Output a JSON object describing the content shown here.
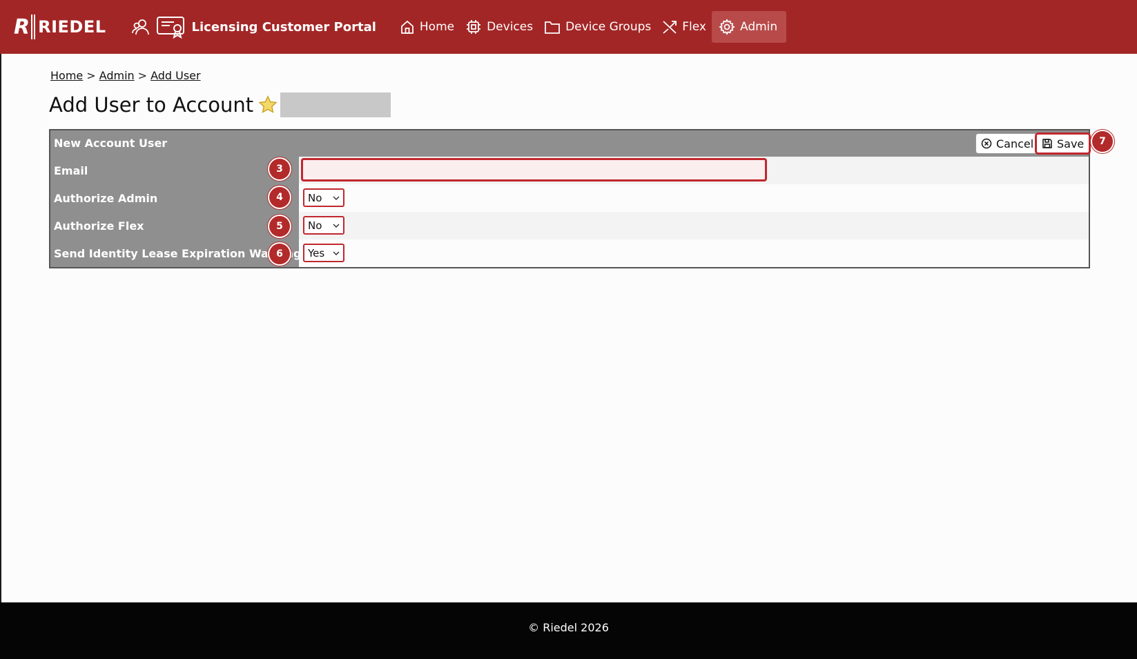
{
  "brand": {
    "logo_mark": "R",
    "logo_text": "RIEDEL",
    "portal_title": "Licensing Customer Portal",
    "accent": "#a32626"
  },
  "nav": {
    "items": [
      {
        "label": "Home",
        "icon": "home-icon"
      },
      {
        "label": "Devices",
        "icon": "chip-icon"
      },
      {
        "label": "Device Groups",
        "icon": "folder-icon"
      },
      {
        "label": "Flex",
        "icon": "shuffle-icon"
      },
      {
        "label": "Admin",
        "icon": "gear-icon",
        "active": true
      }
    ]
  },
  "breadcrumb": {
    "items": [
      "Home",
      "Admin",
      "Add User"
    ],
    "separator": ">"
  },
  "page": {
    "title": "Add User to Account"
  },
  "panel": {
    "title": "New Account User",
    "cancel_label": "Cancel",
    "save_label": "Save",
    "rows": [
      {
        "label": "Email",
        "type": "input",
        "value": "",
        "marker": "3"
      },
      {
        "label": "Authorize Admin",
        "type": "select",
        "value": "No",
        "marker": "4"
      },
      {
        "label": "Authorize Flex",
        "type": "select",
        "value": "No",
        "marker": "5"
      },
      {
        "label": "Send Identity Lease Expiration Warning E",
        "type": "select",
        "value": "Yes",
        "marker": "6"
      }
    ],
    "save_marker": "7"
  },
  "footer": {
    "text": "© Riedel 2026"
  }
}
